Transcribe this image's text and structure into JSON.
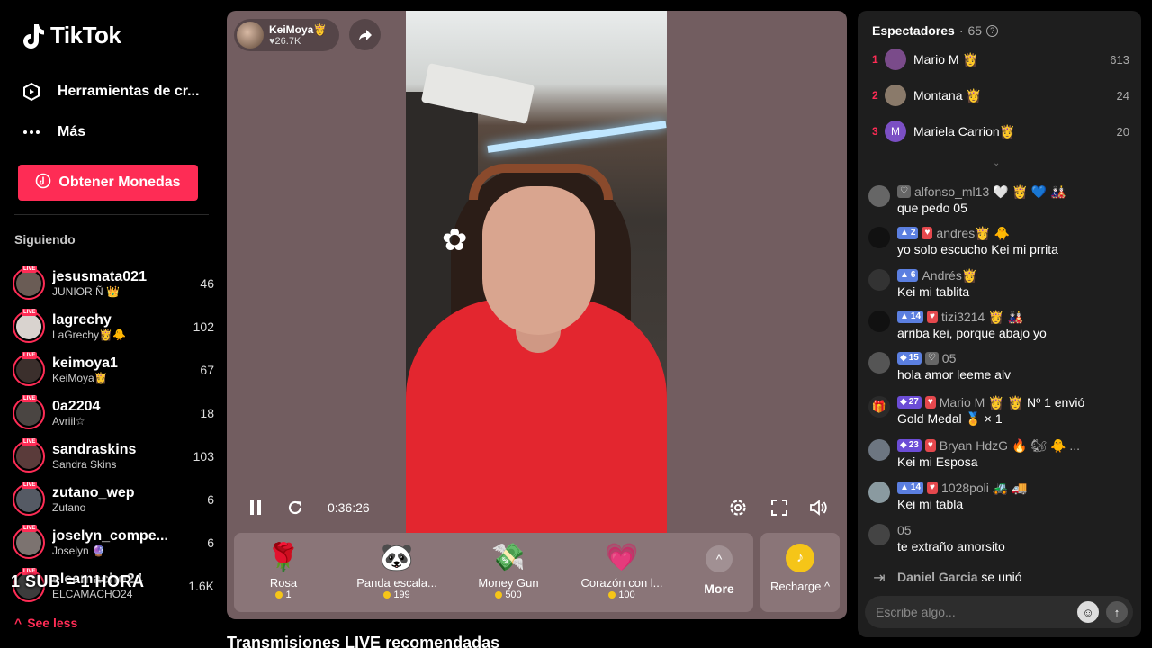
{
  "brand": {
    "name": "TikTok"
  },
  "nav": {
    "creator_tools": "Herramientas de cr...",
    "more": "Más",
    "get_coins": "Obtener Monedas"
  },
  "following": {
    "title": "Siguiendo",
    "items": [
      {
        "name": "jesusmata021",
        "sub": "JUNIOR Ñ 👑",
        "count": "46"
      },
      {
        "name": "lagrechy",
        "sub": "LaGrechy👸🐥",
        "count": "102"
      },
      {
        "name": "keimoya1",
        "sub": "KeiMoya👸",
        "count": "67"
      },
      {
        "name": "0a2204",
        "sub": "Avriil☆",
        "count": "18"
      },
      {
        "name": "sandraskins",
        "sub": "Sandra Skins",
        "count": "103"
      },
      {
        "name": "zutano_wep",
        "sub": "Zutano",
        "count": "6"
      },
      {
        "name": "joselyn_compe...",
        "sub": "Joselyn 🔮",
        "count": "6"
      },
      {
        "name": "elcamacho24",
        "sub": "ELCAMACHO24",
        "count": "1.6K"
      }
    ],
    "see_less": "See less"
  },
  "overlay_text": "1 SUB = 1 HORA",
  "player": {
    "host_name": "KeiMoya👸",
    "host_likes": "26.7K",
    "elapsed": "0:36:26"
  },
  "gifts": [
    {
      "name": "Rosa",
      "price": "1",
      "icon": "rose-icon",
      "glyph": "🌹"
    },
    {
      "name": "Panda escala...",
      "price": "199",
      "icon": "panda-icon",
      "glyph": "🐼"
    },
    {
      "name": "Money Gun",
      "price": "500",
      "icon": "money-gun-icon",
      "glyph": "💸"
    },
    {
      "name": "Corazón con l...",
      "price": "100",
      "icon": "heart-icon",
      "glyph": "💗"
    }
  ],
  "more_label": "More",
  "recharge_label": "Recharge",
  "recommended_title": "Transmisiones LIVE recomendadas",
  "viewers": {
    "title": "Espectadores",
    "count": "65",
    "top": [
      {
        "rank": "1",
        "name": "Mario M 👸",
        "score": "613"
      },
      {
        "rank": "2",
        "name": "Montana 👸",
        "score": "24"
      },
      {
        "rank": "3",
        "name": "Mariela Carrion👸",
        "score": "20",
        "initial": "M"
      }
    ]
  },
  "chat": [
    {
      "name": "alfonso_ml13",
      "extra": "🤍 👸 💙 🎎",
      "text": "que pedo 05",
      "badges": []
    },
    {
      "name": "andres👸 🐥",
      "extra": "",
      "text": "yo solo escucho Kei mi prrita",
      "badges": [
        {
          "t": "2",
          "c": "blue"
        }
      ]
    },
    {
      "name": "Andrés👸",
      "extra": "",
      "text": "Kei mi tablita",
      "badges": [
        {
          "t": "6",
          "c": "blue"
        }
      ]
    },
    {
      "name": "tizi3214",
      "extra": "👸 🎎",
      "text": "arriba kei, porque abajo yo",
      "badges": [
        {
          "t": "14",
          "c": "blue"
        }
      ]
    },
    {
      "name": "05",
      "extra": "",
      "text": "hola amor leeme alv",
      "badges": [
        {
          "t": "15",
          "c": "blue"
        }
      ]
    },
    {
      "name": "Mario M",
      "extra": "👸 👸 Nº 1 envió",
      "text": "Gold Medal 🏅 × 1",
      "badges": [
        {
          "t": "27",
          "c": "purple"
        }
      ]
    },
    {
      "name": "Bryan HdzG",
      "extra": "🔥 🐿 🐥 ...",
      "text": "Kei mi Esposa",
      "badges": [
        {
          "t": "23",
          "c": "purple"
        }
      ]
    },
    {
      "name": "1028poli",
      "extra": "🚜 🚚",
      "text": "Kei mi tabla",
      "badges": [
        {
          "t": "14",
          "c": "blue"
        }
      ]
    },
    {
      "name": "05",
      "extra": "",
      "text": "te extraño amorsito",
      "badges": []
    }
  ],
  "join_notice": {
    "name": "Daniel Garcia",
    "action": "se unió"
  },
  "comment": {
    "placeholder": "Escribe algo..."
  },
  "colors": {
    "accent": "#fe2c55",
    "player_bg": "#725d60",
    "panel_bg": "#1e1e1e"
  }
}
